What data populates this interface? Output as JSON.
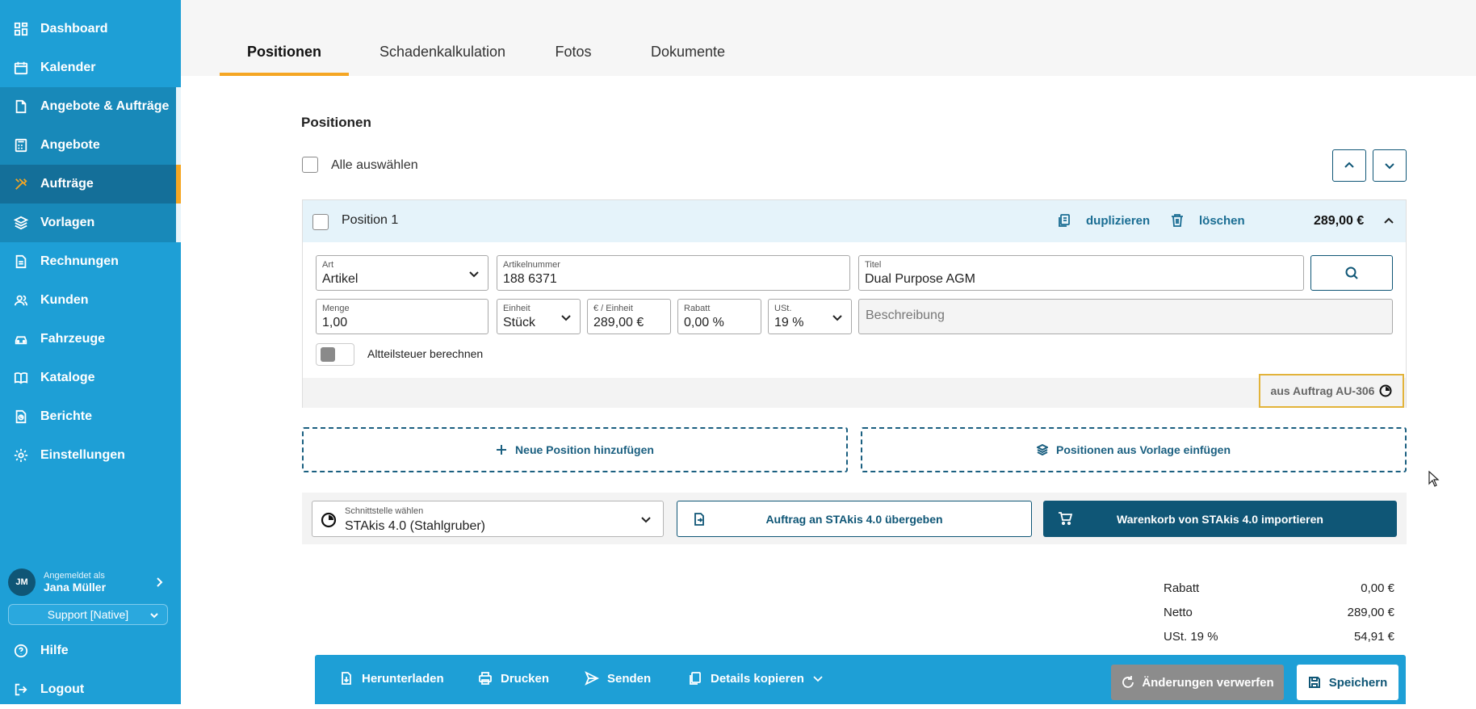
{
  "sidebar": {
    "items": [
      {
        "label": "Dashboard",
        "icon": "dashboard-icon"
      },
      {
        "label": "Kalender",
        "icon": "calendar-icon"
      },
      {
        "label": "Angebote & Aufträge",
        "icon": "document-icon"
      },
      {
        "label": "Angebote",
        "icon": "calculator-icon"
      },
      {
        "label": "Aufträge",
        "icon": "tools-icon"
      },
      {
        "label": "Vorlagen",
        "icon": "layers-icon"
      },
      {
        "label": "Rechnungen",
        "icon": "invoice-icon"
      },
      {
        "label": "Kunden",
        "icon": "users-icon"
      },
      {
        "label": "Fahrzeuge",
        "icon": "car-icon"
      },
      {
        "label": "Kataloge",
        "icon": "book-icon"
      },
      {
        "label": "Berichte",
        "icon": "report-icon"
      },
      {
        "label": "Einstellungen",
        "icon": "gear-icon"
      }
    ],
    "user": {
      "caption": "Angemeldet als",
      "name": "Jana Müller",
      "initials": "JM"
    },
    "support_select": "Support [Native]",
    "help_label": "Hilfe",
    "logout_label": "Logout"
  },
  "tabs": [
    {
      "label": "Positionen",
      "active": true
    },
    {
      "label": "Schadenkalkulation",
      "active": false
    },
    {
      "label": "Fotos",
      "active": false
    },
    {
      "label": "Dokumente",
      "active": false
    }
  ],
  "positions": {
    "title": "Positionen",
    "select_all_label": "Alle auswählen",
    "item": {
      "title": "Position 1",
      "duplicate_label": "duplizieren",
      "delete_label": "löschen",
      "price": "289,00 €",
      "fields": {
        "art": {
          "label": "Art",
          "value": "Artikel"
        },
        "artikelnummer": {
          "label": "Artikelnummer",
          "value": "188 6371"
        },
        "titel": {
          "label": "Titel",
          "value": "Dual Purpose AGM"
        },
        "menge": {
          "label": "Menge",
          "value": "1,00"
        },
        "einheit": {
          "label": "Einheit",
          "value": "Stück"
        },
        "preis_einheit": {
          "label": "€ / Einheit",
          "value": "289,00 €"
        },
        "rabatt": {
          "label": "Rabatt",
          "value": "0,00 %"
        },
        "ust": {
          "label": "USt.",
          "value": "19 %"
        },
        "beschreibung": {
          "placeholder": "Beschreibung"
        }
      },
      "altteilsteuer_label": "Altteilsteuer berechnen",
      "origin_label": "aus Auftrag AU-306"
    },
    "add_position_label": "Neue Position hinzufügen",
    "from_template_label": "Positionen aus Vorlage einfügen"
  },
  "interface": {
    "select_label": "Schnittstelle wählen",
    "select_value": "STAkis 4.0 (Stahlgruber)",
    "transfer_label": "Auftrag an STAkis 4.0 übergeben",
    "import_label": "Warenkorb von STAkis 4.0 importieren"
  },
  "totals": [
    {
      "label": "Rabatt",
      "value": "0,00 €"
    },
    {
      "label": "Netto",
      "value": "289,00 €"
    },
    {
      "label": "USt. 19 %",
      "value": "54,91 €"
    }
  ],
  "bottom_bar": {
    "download_label": "Herunterladen",
    "print_label": "Drucken",
    "send_label": "Senden",
    "copy_details_label": "Details kopieren",
    "discard_label": "Änderungen verwerfen",
    "save_label": "Speichern"
  },
  "colors": {
    "sidebar": "#1e9fd6",
    "accent": "#f5a623",
    "primary_dark": "#0f5676"
  }
}
